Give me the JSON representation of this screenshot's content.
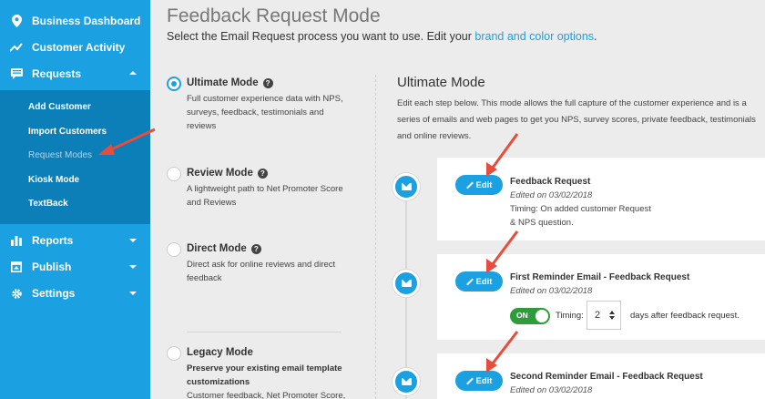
{
  "sidebar": {
    "top_items": [
      {
        "label": "Business Dashboard",
        "icon": "map-pin-icon"
      },
      {
        "label": "Customer Activity",
        "icon": "trend-line-icon"
      },
      {
        "label": "Requests",
        "icon": "message-icon"
      }
    ],
    "sub_items": [
      {
        "label": "Add Customer"
      },
      {
        "label": "Import Customers"
      },
      {
        "label": "Request Modes"
      },
      {
        "label": "Kiosk Mode"
      },
      {
        "label": "TextBack"
      }
    ],
    "bottom_items": [
      {
        "label": "Reports",
        "icon": "bar-chart-icon"
      },
      {
        "label": "Publish",
        "icon": "publish-icon"
      },
      {
        "label": "Settings",
        "icon": "gear-icon"
      }
    ]
  },
  "header": {
    "title": "Feedback Request Mode",
    "subtitle_prefix": "Select the Email Request process you want to use. Edit your ",
    "subtitle_link": "brand and color options",
    "subtitle_suffix": "."
  },
  "modes": [
    {
      "title": "Ultimate Mode",
      "desc": "Full customer experience data with NPS, surveys, feedback, testimonials and reviews",
      "selected": true
    },
    {
      "title": "Review Mode",
      "desc": "A lightweight path to Net Promoter Score and Reviews",
      "selected": false
    },
    {
      "title": "Direct Mode",
      "desc": "Direct ask for online reviews and direct feedback",
      "selected": false
    },
    {
      "title": "Legacy Mode",
      "desc_strong": "Preserve your existing email template customizations",
      "desc": "Customer feedback, Net Promoter Score,",
      "selected": false
    }
  ],
  "right": {
    "title": "Ultimate Mode",
    "description": "Edit each step below. This mode allows the full capture of the customer experience and is a series of emails and web pages to get you NPS, survey scores, private feedback, testimonials and online reviews."
  },
  "steps": [
    {
      "edit_label": "Edit",
      "title": "Feedback Request",
      "date": "Edited on 03/02/2018",
      "timing": "Timing: On added customer Request & NPS question."
    },
    {
      "edit_label": "Edit",
      "title": "First Reminder Email - Feedback Request",
      "date": "Edited on 03/02/2018",
      "toggle_label": "ON",
      "timing_label": "Timing:",
      "days_value": "2",
      "after_label": "days after feedback request."
    },
    {
      "edit_label": "Edit",
      "title": "Second Reminder Email - Feedback Request",
      "date": "Edited on 03/02/2018"
    }
  ],
  "colors": {
    "sidebar": "#1ba1e2",
    "subnav": "#0d7fb8",
    "accent": "#1ba1e2",
    "toggle_on": "#2e9c3a",
    "annotation": "#e74c3c"
  }
}
